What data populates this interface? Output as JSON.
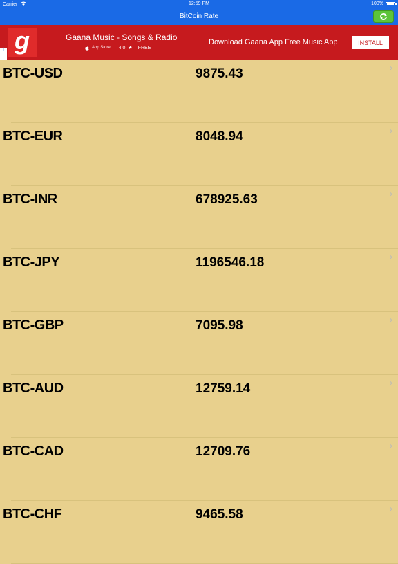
{
  "status_bar": {
    "carrier": "Carrier",
    "time": "12:59 PM",
    "battery": "100%"
  },
  "nav": {
    "title": "BitCoin Rate"
  },
  "ad": {
    "logo_letter": "g",
    "info_glyph": "i",
    "title": "Gaana Music - Songs & Radio",
    "store": "App Store",
    "rating": "4.0",
    "star": "★",
    "price": "FREE",
    "description": "Download Gaana App Free Music App",
    "install_label": "INSTALL"
  },
  "rates": [
    {
      "pair": "BTC-USD",
      "value": "9875.43"
    },
    {
      "pair": "BTC-EUR",
      "value": "8048.94"
    },
    {
      "pair": "BTC-INR",
      "value": "678925.63"
    },
    {
      "pair": "BTC-JPY",
      "value": "1196546.18"
    },
    {
      "pair": "BTC-GBP",
      "value": "7095.98"
    },
    {
      "pair": "BTC-AUD",
      "value": "12759.14"
    },
    {
      "pair": "BTC-CAD",
      "value": "12709.76"
    },
    {
      "pair": "BTC-CHF",
      "value": "9465.58"
    }
  ],
  "chevron_glyph": "›",
  "colors": {
    "nav_blue": "#1a6ae6",
    "ad_red": "#c61a1e",
    "background": "#e8d08d",
    "refresh_green": "#5cc43a"
  }
}
